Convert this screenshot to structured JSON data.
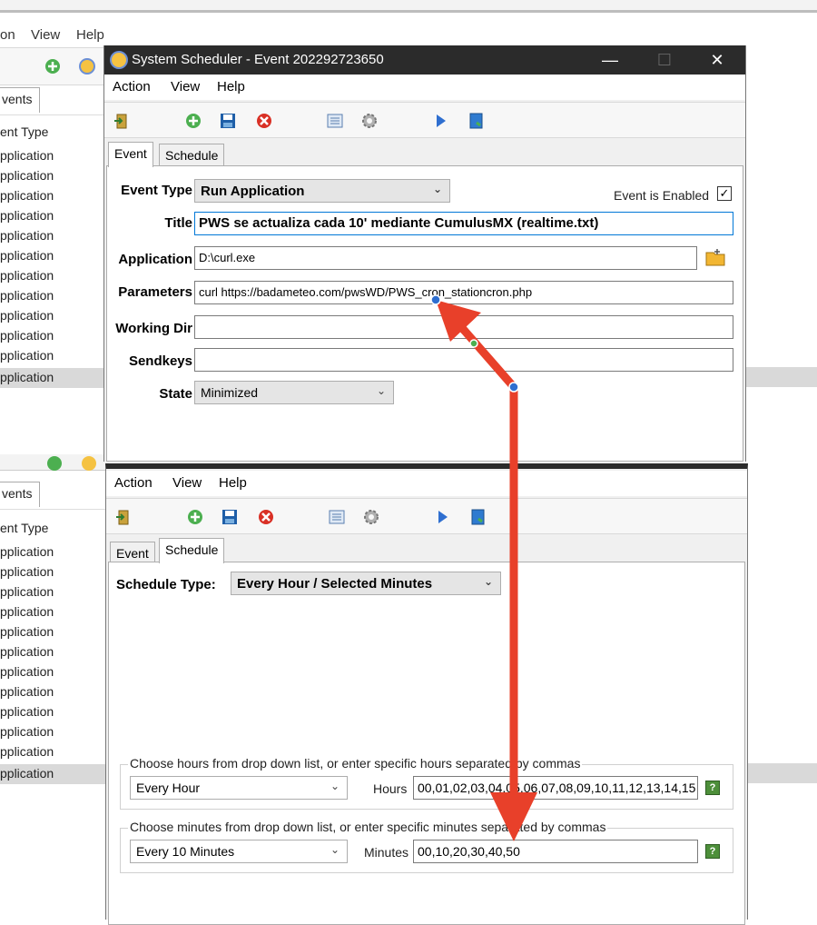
{
  "background": {
    "menu": [
      "on",
      "View",
      "Help"
    ],
    "tab_label": "vents",
    "column_header": "ent Type",
    "rows_top": [
      "pplication",
      "pplication",
      "pplication",
      "pplication",
      "pplication",
      "pplication",
      "pplication",
      "pplication",
      "pplication",
      "pplication",
      "pplication",
      "pplication"
    ],
    "rows_bottom": [
      "pplication",
      "pplication",
      "pplication",
      "pplication",
      "pplication",
      "pplication",
      "pplication",
      "pplication",
      "pplication",
      "pplication",
      "pplication",
      "pplication"
    ]
  },
  "top_dialog": {
    "title": "System Scheduler - Event 202292723650",
    "window_buttons": {
      "minimize": "—",
      "maximize": "☐",
      "close": "✕"
    },
    "menu": [
      "Action",
      "View",
      "Help"
    ],
    "tabs": [
      "Event",
      "Schedule"
    ],
    "active_tab": "Event",
    "event_type_label": "Event Type",
    "event_type_value": "Run Application",
    "enabled_label": "Event is Enabled",
    "enabled_checked": "✓",
    "title_label": "Title",
    "title_value": "PWS se actualiza cada 10' mediante CumulusMX (realtime.txt)",
    "application_label": "Application",
    "application_value": "D:\\curl.exe",
    "parameters_label": "Parameters",
    "parameters_value": "curl https://badameteo.com/pwsWD/PWS_cron_stationcron.php",
    "working_dir_label": "Working Dir",
    "working_dir_value": "",
    "sendkeys_label": "Sendkeys",
    "sendkeys_value": "",
    "state_label": "State",
    "state_value": "Minimized"
  },
  "bottom_dialog": {
    "menu": [
      "Action",
      "View",
      "Help"
    ],
    "tabs": [
      "Event",
      "Schedule"
    ],
    "active_tab": "Schedule",
    "schedule_type_label": "Schedule Type:",
    "schedule_type_value": "Every Hour / Selected Minutes",
    "hours_group_caption": "Choose hours from drop down list, or enter specific hours separated by commas",
    "hours_combo_value": "Every Hour",
    "hours_label": "Hours",
    "hours_value": "00,01,02,03,04,05,06,07,08,09,10,11,12,13,14,15",
    "minutes_group_caption": "Choose minutes from drop down list, or enter specific minutes separated by commas",
    "minutes_combo_value": "Every 10 Minutes",
    "minutes_label": "Minutes",
    "minutes_value": "00,10,20,30,40,50",
    "help_glyph": "?"
  },
  "colors": {
    "arrow": "#e8402a",
    "titlebar": "#2b2b2b",
    "selection": "#d9d9d9"
  }
}
